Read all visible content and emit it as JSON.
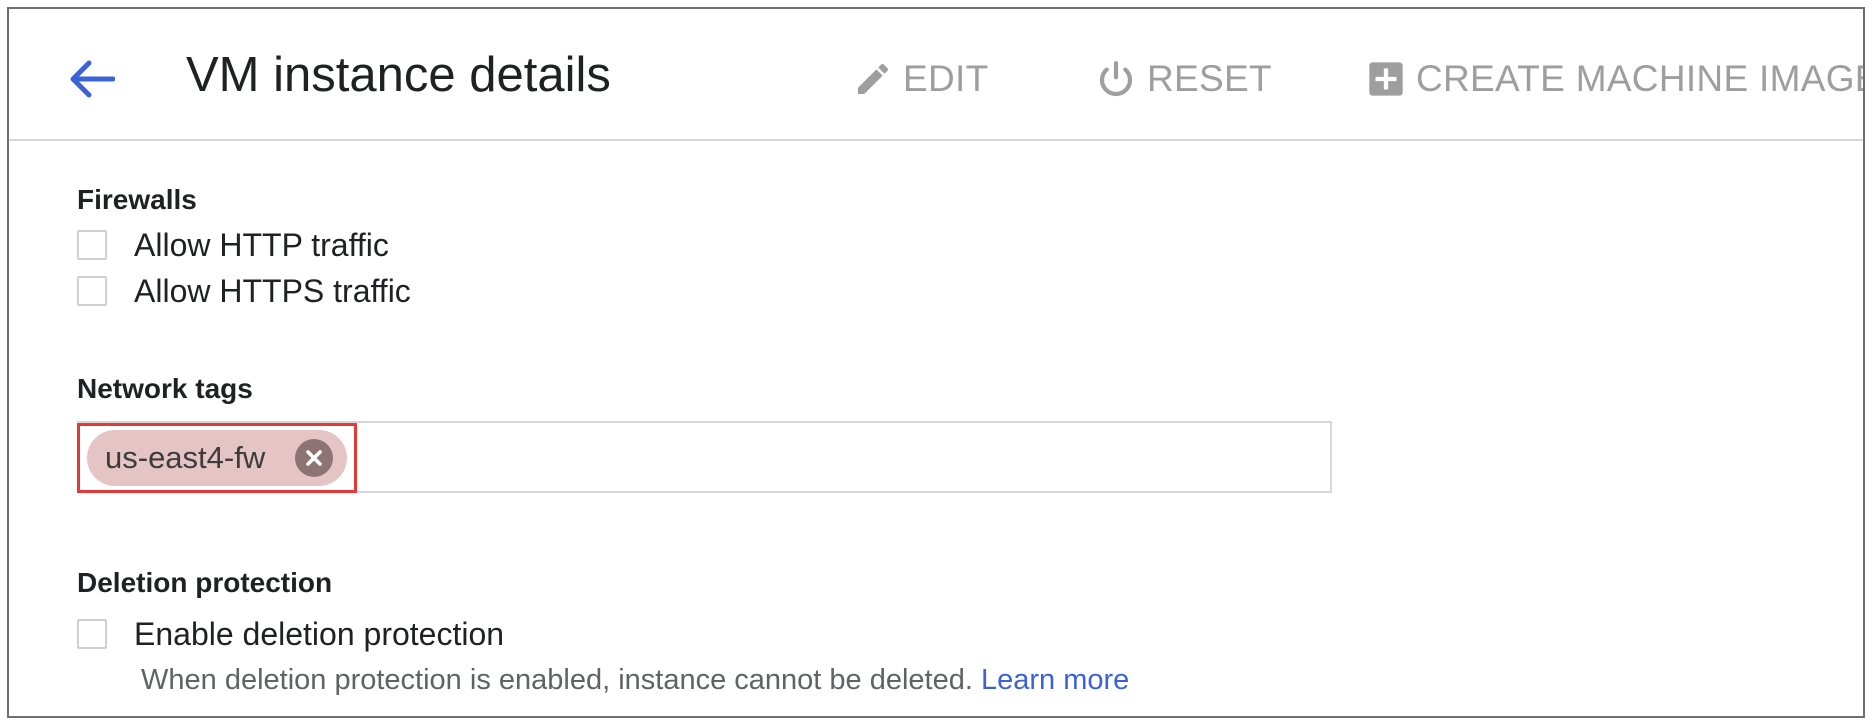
{
  "header": {
    "title": "VM instance details",
    "actions": {
      "edit_label": "EDIT",
      "reset_label": "RESET",
      "create_image_label": "CREATE MACHINE IMAGE"
    }
  },
  "firewalls": {
    "heading": "Firewalls",
    "options": [
      {
        "label": "Allow HTTP traffic",
        "checked": false
      },
      {
        "label": "Allow HTTPS traffic",
        "checked": false
      }
    ]
  },
  "network_tags": {
    "heading": "Network tags",
    "tags": [
      "us-east4-fw"
    ],
    "input_value": ""
  },
  "deletion_protection": {
    "heading": "Deletion protection",
    "checkbox_label": "Enable deletion protection",
    "checked": false,
    "helper_text": "When deletion protection is enabled, instance cannot be deleted.",
    "learn_more_label": "Learn more"
  },
  "colors": {
    "accent_blue": "#3c63d6",
    "action_gray": "#9e9e9e",
    "highlight_red": "#e53935",
    "chip_background": "#e5c4c6"
  },
  "icons": {
    "back": "arrow-left-icon",
    "edit": "pencil-icon",
    "reset": "power-icon",
    "create_image": "add-box-icon",
    "chip_remove": "cancel-circle-icon"
  }
}
